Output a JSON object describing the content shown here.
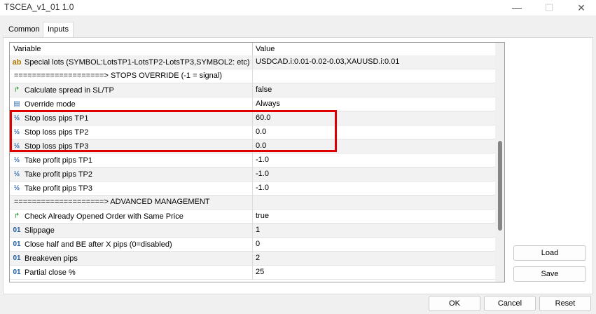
{
  "window": {
    "title": "TSCEA_v1_01 1.0",
    "minimize_glyph": "—",
    "maximize_glyph": "☐",
    "close_glyph": "✕"
  },
  "tabs": [
    {
      "label": "Common",
      "active": false
    },
    {
      "label": "Inputs",
      "active": true
    }
  ],
  "grid": {
    "headers": {
      "variable": "Variable",
      "value": "Value"
    },
    "rows": [
      {
        "icon": "string-icon",
        "glyph": "ab",
        "variable": "Special lots (SYMBOL:LotsTP1-LotsTP2-LotsTP3,SYMBOL2: etc)",
        "value": "USDCAD.i:0.01-0.02-0.03,XAUUSD.i:0.01"
      },
      {
        "icon": "none",
        "glyph": "",
        "variable": "====================> STOPS OVERRIDE (-1 = signal)",
        "value": ""
      },
      {
        "icon": "bool-icon",
        "glyph": "↱",
        "variable": "Calculate spread in SL/TP",
        "value": "false"
      },
      {
        "icon": "enum-icon",
        "glyph": "▤",
        "variable": "Override mode",
        "value": "Always"
      },
      {
        "icon": "double-icon",
        "glyph": "½",
        "variable": "Stop loss pips TP1",
        "value": "60.0"
      },
      {
        "icon": "double-icon",
        "glyph": "½",
        "variable": "Stop loss pips TP2",
        "value": "0.0"
      },
      {
        "icon": "double-icon",
        "glyph": "½",
        "variable": "Stop loss pips TP3",
        "value": "0.0"
      },
      {
        "icon": "double-icon",
        "glyph": "½",
        "variable": "Take profit pips TP1",
        "value": "-1.0"
      },
      {
        "icon": "double-icon",
        "glyph": "½",
        "variable": "Take profit pips TP2",
        "value": "-1.0"
      },
      {
        "icon": "double-icon",
        "glyph": "½",
        "variable": "Take profit pips TP3",
        "value": "-1.0"
      },
      {
        "icon": "none",
        "glyph": "",
        "variable": "====================> ADVANCED MANAGEMENT",
        "value": ""
      },
      {
        "icon": "bool-icon",
        "glyph": "↱",
        "variable": "Check Already Opened Order with Same Price",
        "value": "true"
      },
      {
        "icon": "int-icon",
        "glyph": "01",
        "variable": "Slippage",
        "value": "1"
      },
      {
        "icon": "int-icon",
        "glyph": "01",
        "variable": "Close half and BE after X pips (0=disabled)",
        "value": "0"
      },
      {
        "icon": "int-icon",
        "glyph": "01",
        "variable": "Breakeven pips",
        "value": "2"
      },
      {
        "icon": "int-icon",
        "glyph": "01",
        "variable": "Partial close %",
        "value": "25"
      }
    ]
  },
  "buttons": {
    "load": "Load",
    "save": "Save",
    "ok": "OK",
    "cancel": "Cancel",
    "reset": "Reset"
  },
  "colors": {
    "highlight": "#e00000",
    "row_alt": "#f2f2f2"
  }
}
